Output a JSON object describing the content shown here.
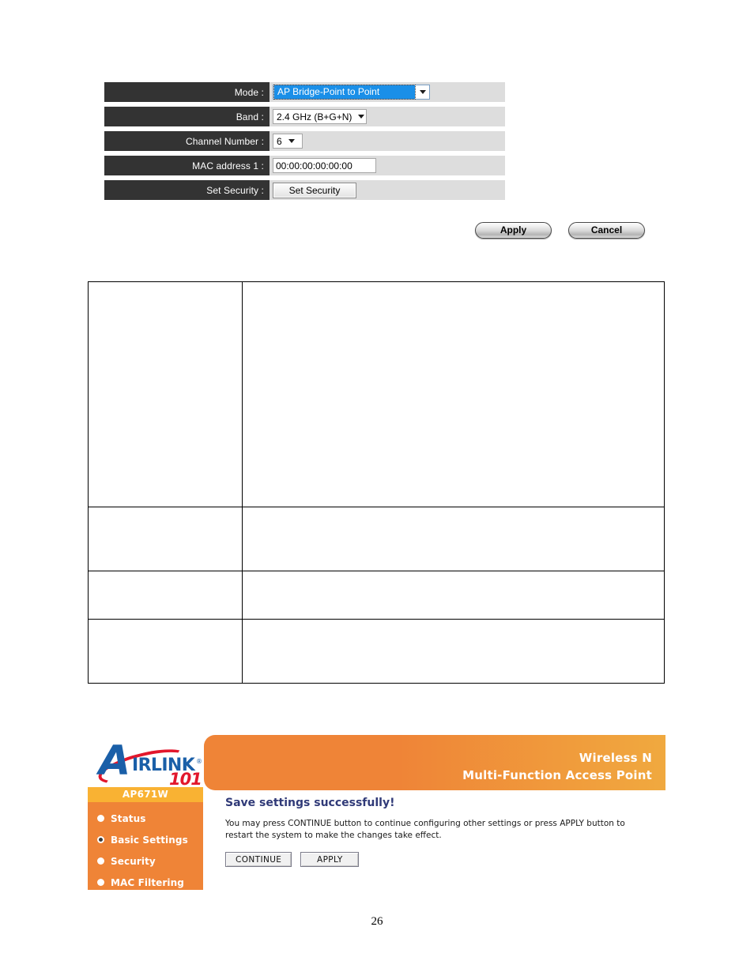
{
  "config_form": {
    "rows": [
      {
        "label": "Mode :",
        "control": "select-focused",
        "value": "AP Bridge-Point to Point",
        "name": "mode"
      },
      {
        "label": "Band :",
        "control": "select",
        "value": "2.4 GHz (B+G+N)",
        "name": "band"
      },
      {
        "label": "Channel Number :",
        "control": "select",
        "value": "6",
        "name": "channel-number"
      },
      {
        "label": "MAC address 1 :",
        "control": "text",
        "value": "00:00:00:00:00:00",
        "name": "mac-address-1"
      },
      {
        "label": "Set Security :",
        "control": "button",
        "value": "Set Security",
        "name": "set-security"
      }
    ]
  },
  "actions": {
    "apply_label": "Apply",
    "cancel_label": "Cancel"
  },
  "description_table": {
    "rows": [
      {
        "term": "",
        "definition": ""
      },
      {
        "term": "",
        "definition": ""
      },
      {
        "term": "",
        "definition": ""
      },
      {
        "term": "",
        "definition": ""
      }
    ]
  },
  "router_ui": {
    "logo": {
      "brand_a": "A",
      "brand_word": "IRLINK",
      "registered": "®",
      "model_number": "101"
    },
    "banner": {
      "line1": "Wireless N",
      "line2": "Multi-Function Access Point",
      "color": "#ef8437"
    },
    "sidebar": {
      "model": "AP671W",
      "items": [
        {
          "label": "Status",
          "active": false
        },
        {
          "label": "Basic Settings",
          "active": true
        },
        {
          "label": "Security",
          "active": false
        },
        {
          "label": "MAC Filtering",
          "active": false
        }
      ]
    },
    "content": {
      "title": "Save settings successfully!",
      "description": "You may press CONTINUE button to continue configuring other settings or press APPLY button to restart the system to make the changes take effect.",
      "buttons": [
        {
          "label": "CONTINUE"
        },
        {
          "label": "APPLY"
        }
      ]
    }
  },
  "page": {
    "number": "26"
  }
}
